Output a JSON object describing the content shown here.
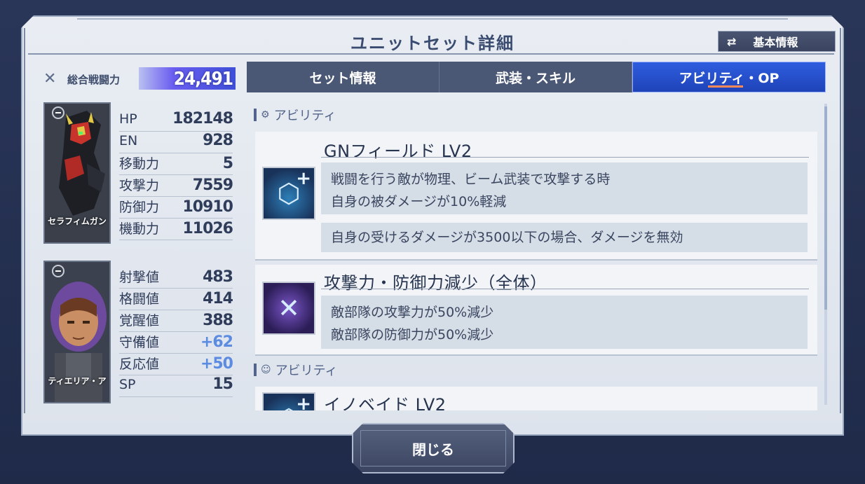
{
  "title": "ユニットセット詳細",
  "basic_info_button": "基本情報",
  "total_power": {
    "label": "総合戦闘力",
    "value": "24,491"
  },
  "unit": {
    "name": "セラフィムガン",
    "stats": [
      {
        "label": "HP",
        "value": "182148"
      },
      {
        "label": "EN",
        "value": "928"
      },
      {
        "label": "移動力",
        "value": "5"
      },
      {
        "label": "攻撃力",
        "value": "7559"
      },
      {
        "label": "防御力",
        "value": "10910"
      },
      {
        "label": "機動力",
        "value": "11026"
      }
    ]
  },
  "pilot": {
    "name": "ティエリア・ア",
    "stats": [
      {
        "label": "射撃値",
        "value": "483"
      },
      {
        "label": "格闘値",
        "value": "414"
      },
      {
        "label": "覚醒値",
        "value": "388"
      },
      {
        "label": "守備値",
        "value": "+62"
      },
      {
        "label": "反応値",
        "value": "+50"
      },
      {
        "label": "SP",
        "value": "15"
      }
    ]
  },
  "tabs": [
    {
      "label": "セット情報",
      "active": false
    },
    {
      "label": "武装・スキル",
      "active": false
    },
    {
      "label": "アビリティ・OP",
      "active": true
    }
  ],
  "sections": [
    {
      "header": "アビリティ",
      "icon": "unit-ability-icon"
    },
    {
      "header": "アビリティ",
      "icon": "pilot-ability-icon"
    }
  ],
  "abilities": [
    {
      "title": "GNフィールド LV2",
      "icon": "shield-plus-icon",
      "desc1_line1": "戦闘を行う敵が物理、ビーム武装で攻撃する時",
      "desc1_line2": "自身の被ダメージが10%軽減",
      "desc2_line1": "自身の受けるダメージが3500以下の場合、ダメージを無効"
    },
    {
      "title": "攻撃力・防御力減少（全体）",
      "icon": "debuff-slash-icon",
      "desc1_line1": "敵部隊の攻撃力が50%減少",
      "desc1_line2": "敵部隊の防御力が50%減少"
    },
    {
      "title": "イノベイド LV2",
      "icon": "shield-plus-icon"
    }
  ],
  "close_button": "閉じる",
  "colors": {
    "active_tab": "#2e5ddf",
    "power_bar": "#6b5ef0",
    "plus_value": "#5c8be2"
  }
}
